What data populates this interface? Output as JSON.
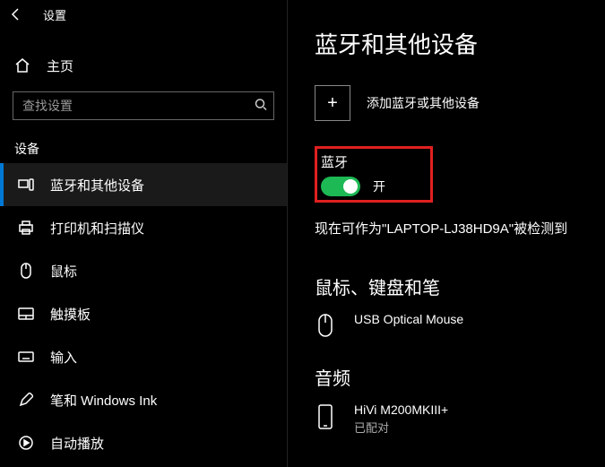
{
  "header": {
    "title": "设置"
  },
  "home": {
    "label": "主页"
  },
  "search": {
    "placeholder": "查找设置"
  },
  "section": {
    "label": "设备"
  },
  "nav": {
    "items": [
      {
        "label": "蓝牙和其他设备"
      },
      {
        "label": "打印机和扫描仪"
      },
      {
        "label": "鼠标"
      },
      {
        "label": "触摸板"
      },
      {
        "label": "输入"
      },
      {
        "label": "笔和 Windows Ink"
      },
      {
        "label": "自动播放"
      }
    ]
  },
  "page": {
    "title": "蓝牙和其他设备",
    "add_label": "添加蓝牙或其他设备",
    "bluetooth_label": "蓝牙",
    "toggle_state": "开",
    "discoverable": "现在可作为\"LAPTOP-LJ38HD9A\"被检测到",
    "group_mouse": "鼠标、键盘和笔",
    "group_audio": "音频",
    "devices": {
      "mouse": {
        "name": "USB Optical Mouse"
      },
      "audio": {
        "name": "HiVi M200MKIII+",
        "status": "已配对"
      }
    }
  }
}
